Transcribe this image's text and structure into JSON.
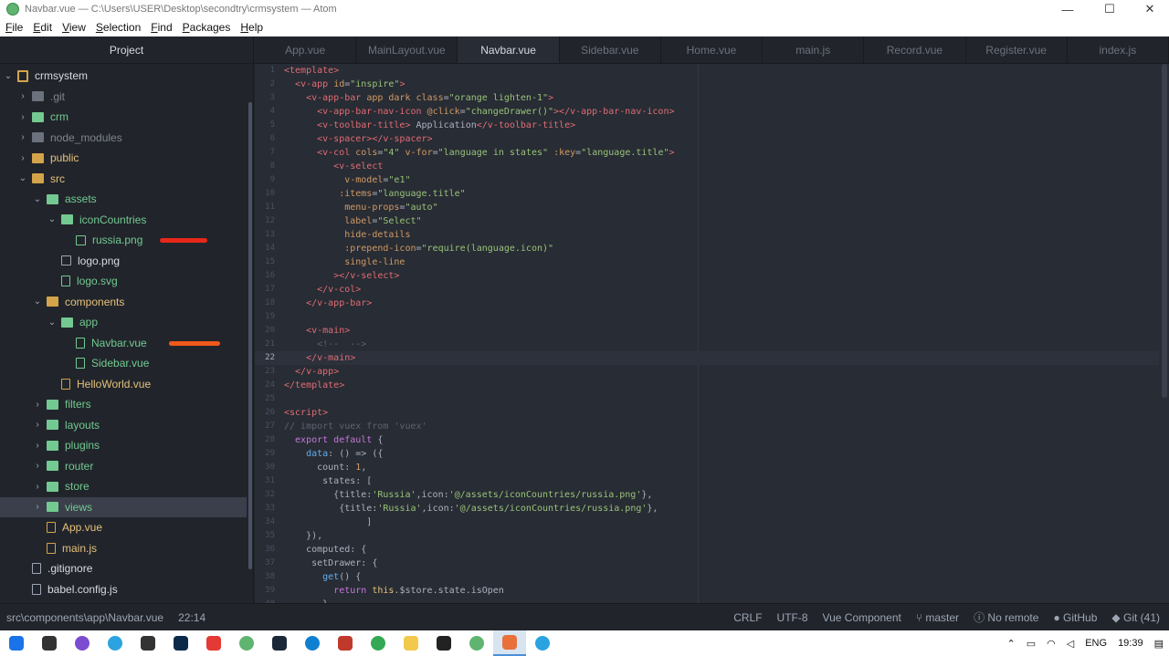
{
  "window": {
    "title": "Navbar.vue — C:\\Users\\USER\\Desktop\\secondtry\\crmsystem — Atom",
    "minimize": "—",
    "maximize": "☐",
    "close": "✕"
  },
  "menu": [
    "File",
    "Edit",
    "View",
    "Selection",
    "Find",
    "Packages",
    "Help"
  ],
  "tree": {
    "header": "Project",
    "items": [
      {
        "label": "crmsystem",
        "kind": "repo",
        "chev": "⌄",
        "color": "normal",
        "depth": 0
      },
      {
        "label": ".git",
        "kind": "folder",
        "chev": "›",
        "color": "grey",
        "depth": 1
      },
      {
        "label": "crm",
        "kind": "folder",
        "chev": "›",
        "color": "green",
        "depth": 1
      },
      {
        "label": "node_modules",
        "kind": "folder",
        "chev": "›",
        "color": "grey",
        "depth": 1
      },
      {
        "label": "public",
        "kind": "folder",
        "chev": "›",
        "color": "yellow",
        "depth": 1
      },
      {
        "label": "src",
        "kind": "folder",
        "chev": "⌄",
        "color": "yellow",
        "depth": 1
      },
      {
        "label": "assets",
        "kind": "folder",
        "chev": "⌄",
        "color": "green",
        "depth": 2
      },
      {
        "label": "iconCountries",
        "kind": "folder",
        "chev": "⌄",
        "color": "green",
        "depth": 3
      },
      {
        "label": "russia.png",
        "kind": "img",
        "chev": "",
        "color": "green",
        "depth": 4
      },
      {
        "label": "logo.png",
        "kind": "img",
        "chev": "",
        "color": "normal",
        "depth": 3
      },
      {
        "label": "logo.svg",
        "kind": "file",
        "chev": "",
        "color": "green",
        "depth": 3
      },
      {
        "label": "components",
        "kind": "folder",
        "chev": "⌄",
        "color": "yellow",
        "depth": 2
      },
      {
        "label": "app",
        "kind": "folder",
        "chev": "⌄",
        "color": "green",
        "depth": 3
      },
      {
        "label": "Navbar.vue",
        "kind": "file",
        "chev": "",
        "color": "green",
        "depth": 4
      },
      {
        "label": "Sidebar.vue",
        "kind": "file",
        "chev": "",
        "color": "green",
        "depth": 4
      },
      {
        "label": "HelloWorld.vue",
        "kind": "file",
        "chev": "",
        "color": "yellow",
        "depth": 3
      },
      {
        "label": "filters",
        "kind": "folder",
        "chev": "›",
        "color": "green",
        "depth": 2
      },
      {
        "label": "layouts",
        "kind": "folder",
        "chev": "›",
        "color": "green",
        "depth": 2
      },
      {
        "label": "plugins",
        "kind": "folder",
        "chev": "›",
        "color": "green",
        "depth": 2
      },
      {
        "label": "router",
        "kind": "folder",
        "chev": "›",
        "color": "green",
        "depth": 2
      },
      {
        "label": "store",
        "kind": "folder",
        "chev": "›",
        "color": "green",
        "depth": 2
      },
      {
        "label": "views",
        "kind": "folder",
        "chev": "›",
        "color": "green",
        "depth": 2,
        "selected": true
      },
      {
        "label": "App.vue",
        "kind": "file",
        "chev": "",
        "color": "yellow",
        "depth": 2
      },
      {
        "label": "main.js",
        "kind": "file",
        "chev": "",
        "color": "yellow",
        "depth": 2
      },
      {
        "label": ".gitignore",
        "kind": "file",
        "chev": "",
        "color": "normal",
        "depth": 1
      },
      {
        "label": "babel.config.js",
        "kind": "file",
        "chev": "",
        "color": "normal",
        "depth": 1
      }
    ]
  },
  "tabs": [
    "App.vue",
    "MainLayout.vue",
    "Navbar.vue",
    "Sidebar.vue",
    "Home.vue",
    "main.js",
    "Record.vue",
    "Register.vue",
    "index.js"
  ],
  "active_tab": "Navbar.vue",
  "code": [
    {
      "n": "1",
      "t": [
        [
          "<template>",
          "#e06c75"
        ]
      ]
    },
    {
      "n": "2",
      "t": [
        [
          "  <v-app ",
          "#e06c75"
        ],
        [
          "id",
          "#d19a66"
        ],
        [
          "=",
          "#abb2bf"
        ],
        [
          "\"inspire\"",
          "#98c379"
        ],
        [
          ">",
          "#e06c75"
        ]
      ]
    },
    {
      "n": "3",
      "t": [
        [
          "    <v-app-bar ",
          "#e06c75"
        ],
        [
          "app dark class",
          "#d19a66"
        ],
        [
          "=",
          "#abb2bf"
        ],
        [
          "\"orange lighten-1\"",
          "#98c379"
        ],
        [
          ">",
          "#e06c75"
        ]
      ]
    },
    {
      "n": "4",
      "t": [
        [
          "      <v-app-bar-nav-icon ",
          "#e06c75"
        ],
        [
          "@click",
          "#d19a66"
        ],
        [
          "=",
          "#abb2bf"
        ],
        [
          "\"changeDrawer()\"",
          "#98c379"
        ],
        [
          "></v-app-bar-nav-icon>",
          "#e06c75"
        ]
      ]
    },
    {
      "n": "5",
      "t": [
        [
          "      <v-toolbar-title>",
          "#e06c75"
        ],
        [
          " Application",
          "#abb2bf"
        ],
        [
          "</v-toolbar-title>",
          "#e06c75"
        ]
      ]
    },
    {
      "n": "6",
      "t": [
        [
          "      <v-spacer></v-spacer>",
          "#e06c75"
        ]
      ]
    },
    {
      "n": "7",
      "t": [
        [
          "      <v-col ",
          "#e06c75"
        ],
        [
          "cols",
          "#d19a66"
        ],
        [
          "=",
          "#abb2bf"
        ],
        [
          "\"4\"",
          "#98c379"
        ],
        [
          " v-for",
          "#d19a66"
        ],
        [
          "=",
          "#abb2bf"
        ],
        [
          "\"language in states\"",
          "#98c379"
        ],
        [
          " :key",
          "#d19a66"
        ],
        [
          "=",
          "#abb2bf"
        ],
        [
          "\"language.title\"",
          "#98c379"
        ],
        [
          ">",
          "#e06c75"
        ]
      ]
    },
    {
      "n": "8",
      "t": [
        [
          "         <v-select",
          "#e06c75"
        ]
      ]
    },
    {
      "n": "9",
      "t": [
        [
          "           v-model",
          "#d19a66"
        ],
        [
          "=",
          "#abb2bf"
        ],
        [
          "\"e1\"",
          "#98c379"
        ]
      ]
    },
    {
      "n": "10",
      "t": [
        [
          "          :items",
          "#d19a66"
        ],
        [
          "=",
          "#abb2bf"
        ],
        [
          "\"language.title\"",
          "#98c379"
        ]
      ]
    },
    {
      "n": "11",
      "t": [
        [
          "           menu-props",
          "#d19a66"
        ],
        [
          "=",
          "#abb2bf"
        ],
        [
          "\"auto\"",
          "#98c379"
        ]
      ]
    },
    {
      "n": "12",
      "t": [
        [
          "           label",
          "#d19a66"
        ],
        [
          "=",
          "#abb2bf"
        ],
        [
          "\"Select\"",
          "#98c379"
        ]
      ]
    },
    {
      "n": "13",
      "t": [
        [
          "           hide-details",
          "#d19a66"
        ]
      ]
    },
    {
      "n": "14",
      "t": [
        [
          "           :prepend-icon",
          "#d19a66"
        ],
        [
          "=",
          "#abb2bf"
        ],
        [
          "\"require(language.icon)\"",
          "#98c379"
        ]
      ]
    },
    {
      "n": "15",
      "t": [
        [
          "           single-line",
          "#d19a66"
        ]
      ]
    },
    {
      "n": "16",
      "t": [
        [
          "         ></v-select>",
          "#e06c75"
        ]
      ]
    },
    {
      "n": "17",
      "t": [
        [
          "      </v-col>",
          "#e06c75"
        ]
      ]
    },
    {
      "n": "18",
      "t": [
        [
          "    </v-app-bar>",
          "#e06c75"
        ]
      ]
    },
    {
      "n": "19",
      "t": []
    },
    {
      "n": "20",
      "t": [
        [
          "    <v-main>",
          "#e06c75"
        ]
      ]
    },
    {
      "n": "21",
      "t": [
        [
          "      <!--  -->",
          "#5c6370"
        ]
      ]
    },
    {
      "n": "22",
      "t": [
        [
          "    </v-main>",
          "#e06c75"
        ]
      ],
      "cur": true
    },
    {
      "n": "23",
      "t": [
        [
          "  </v-app>",
          "#e06c75"
        ]
      ]
    },
    {
      "n": "24",
      "t": [
        [
          "</template>",
          "#e06c75"
        ]
      ]
    },
    {
      "n": "25",
      "t": []
    },
    {
      "n": "26",
      "t": [
        [
          "<script>",
          "#e06c75"
        ]
      ]
    },
    {
      "n": "27",
      "t": [
        [
          "// import vuex from 'vuex'",
          "#5c6370"
        ]
      ]
    },
    {
      "n": "28",
      "t": [
        [
          "  export default",
          "#c678dd"
        ],
        [
          " {",
          "#abb2bf"
        ]
      ]
    },
    {
      "n": "29",
      "t": [
        [
          "    data",
          "#61afef"
        ],
        [
          ": () => ({",
          "#abb2bf"
        ]
      ]
    },
    {
      "n": "30",
      "t": [
        [
          "      count",
          "#abb2bf"
        ],
        [
          ": ",
          "#abb2bf"
        ],
        [
          "1",
          "#d19a66"
        ],
        [
          ",",
          "#abb2bf"
        ]
      ]
    },
    {
      "n": "31",
      "t": [
        [
          "       states: [",
          "#abb2bf"
        ]
      ]
    },
    {
      "n": "32",
      "t": [
        [
          "         {title:",
          "#abb2bf"
        ],
        [
          "'Russia'",
          "#98c379"
        ],
        [
          ",icon:",
          "#abb2bf"
        ],
        [
          "'@/assets/iconCountries/russia.png'",
          "#98c379"
        ],
        [
          "},",
          "#abb2bf"
        ]
      ]
    },
    {
      "n": "33",
      "t": [
        [
          "          {title:",
          "#abb2bf"
        ],
        [
          "'Russia'",
          "#98c379"
        ],
        [
          ",icon:",
          "#abb2bf"
        ],
        [
          "'@/assets/iconCountries/russia.png'",
          "#98c379"
        ],
        [
          "},",
          "#abb2bf"
        ]
      ]
    },
    {
      "n": "34",
      "t": [
        [
          "               ]",
          "#abb2bf"
        ]
      ]
    },
    {
      "n": "35",
      "t": [
        [
          "    }),",
          "#abb2bf"
        ]
      ]
    },
    {
      "n": "36",
      "t": [
        [
          "    computed: {",
          "#abb2bf"
        ]
      ]
    },
    {
      "n": "37",
      "t": [
        [
          "     setDrawer: {",
          "#abb2bf"
        ]
      ]
    },
    {
      "n": "38",
      "t": [
        [
          "       get",
          "#61afef"
        ],
        [
          "() {",
          "#abb2bf"
        ]
      ]
    },
    {
      "n": "39",
      "t": [
        [
          "         return ",
          "#c678dd"
        ],
        [
          "this",
          "#e5c07b"
        ],
        [
          ".$store.state.isOpen",
          "#abb2bf"
        ]
      ]
    },
    {
      "n": "40",
      "t": [
        [
          "       },",
          "#abb2bf"
        ]
      ]
    }
  ],
  "status": {
    "path": "src\\components\\app\\Navbar.vue",
    "cursor": "22:14",
    "line_ending": "CRLF",
    "encoding": "UTF-8",
    "grammar": "Vue Component",
    "branch": "master",
    "remote": "No remote",
    "github": "GitHub",
    "git": "Git (41)"
  },
  "taskbar": {
    "apps": [
      {
        "name": "windows-start-icon",
        "color": "#1a73e8"
      },
      {
        "name": "task-view-icon",
        "color": "#333333"
      },
      {
        "name": "app-purple-icon",
        "color": "#7b4ccf"
      },
      {
        "name": "telegram-icon",
        "color": "#2aa3e0"
      },
      {
        "name": "app-dark-icon",
        "color": "#333333"
      },
      {
        "name": "photoshop-icon",
        "color": "#0b2a4a"
      },
      {
        "name": "yandex-icon",
        "color": "#e53935"
      },
      {
        "name": "app-green-icon",
        "color": "#5fb46f"
      },
      {
        "name": "steam-icon",
        "color": "#1b2838"
      },
      {
        "name": "edge-icon",
        "color": "#0f7fd1"
      },
      {
        "name": "app-red-icon",
        "color": "#c0392b"
      },
      {
        "name": "chrome-icon",
        "color": "#34a853"
      },
      {
        "name": "explorer-icon",
        "color": "#f2c94c"
      },
      {
        "name": "terminal-icon",
        "color": "#222222"
      },
      {
        "name": "atom-icon",
        "color": "#5fb46f"
      },
      {
        "name": "app-active-icon",
        "color": "#e8703a"
      },
      {
        "name": "telegram-2-icon",
        "color": "#2aa3e0"
      }
    ],
    "language": "ENG",
    "time": "19:39"
  }
}
